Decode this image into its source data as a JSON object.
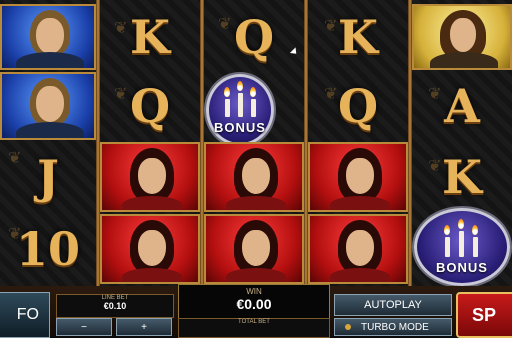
{
  "reels": {
    "letters": {
      "k1": "K",
      "q1": "Q",
      "k2": "K",
      "q2": "Q",
      "q3": "Q",
      "a1": "A",
      "j1": "J",
      "k3": "K",
      "ten": "10"
    },
    "bonus_label": "BONUS"
  },
  "bottom": {
    "info": "FO",
    "line_bet_label": "LINE BET",
    "line_bet_value": "€0.10",
    "minus": "−",
    "plus": "+",
    "win_label": "WIN",
    "win_value": "€0.00",
    "total_bet_label": "TOTAL BET",
    "autoplay": "AUTOPLAY",
    "turbo": "TURBO MODE",
    "spin": "SP"
  },
  "colors": {
    "gold": "#e6b35a",
    "red_bg": "#b30f0f",
    "blue_bg": "#1a3fa8"
  }
}
